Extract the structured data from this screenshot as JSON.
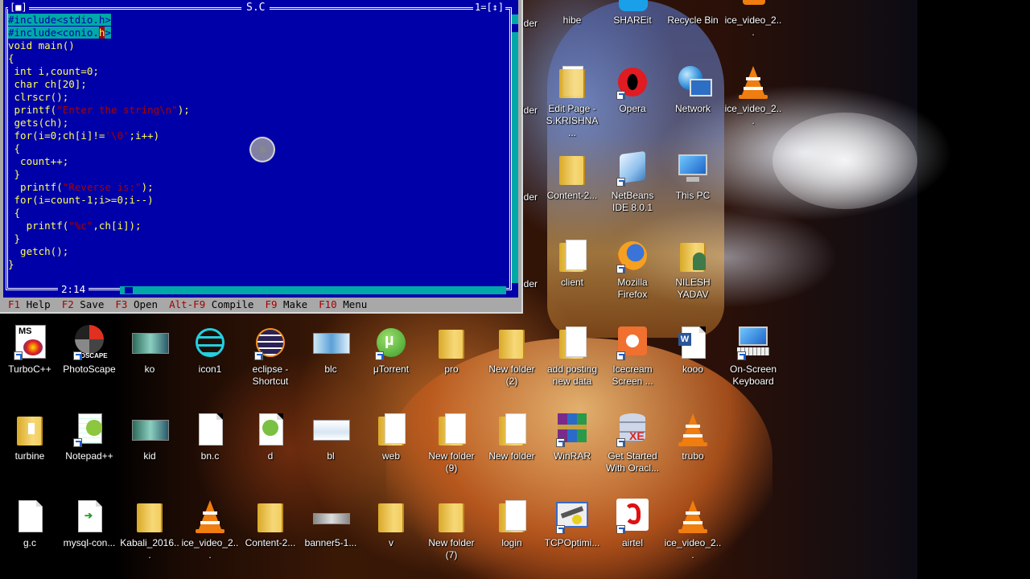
{
  "turbo_c": {
    "title": "S.C",
    "close_box": "[■]",
    "window_number": "1=[↕]",
    "cursor_position": "2:14",
    "code_lines": [
      "#include<stdio.h>",
      "#include<conio.h>",
      "void main()",
      "{",
      " int i,count=0;",
      " char ch[20];",
      " clrscr();",
      " printf(\"Enter the string\\n\");",
      " gets(ch);",
      " for(i=0;ch[i]!='\\0';i++)",
      " {",
      "  count++;",
      " }",
      "  printf(\"Reverse is:\");",
      " for(i=count-1;i>=0;i--)",
      " {",
      "   printf(\"%c\",ch[i]);",
      " }",
      "  getch();",
      "}"
    ],
    "menu": [
      {
        "key": "F1",
        "label": "Help"
      },
      {
        "key": "F2",
        "label": "Save"
      },
      {
        "key": "F3",
        "label": "Open"
      },
      {
        "key": "Alt-F9",
        "label": "Compile"
      },
      {
        "key": "F9",
        "label": "Make"
      },
      {
        "key": "F10",
        "label": "Menu"
      }
    ]
  },
  "desktop": {
    "top_partial_icons": {
      "hibe": "hibe",
      "shareit": "SHAREit",
      "recycle_bin": "Recycle Bin",
      "ice_video_top": "ice_video_2..."
    },
    "icons": {
      "edit_page": "Edit Page - S.KRISHNA ...",
      "opera": "Opera",
      "network": "Network",
      "ice_video_r1": "ice_video_2...",
      "content_2_top": "Content-2...",
      "netbeans": "NetBeans IDE 8.0.1",
      "this_pc": "This PC",
      "client": "client",
      "firefox": "Mozilla Firefox",
      "nilesh": "NILESH YADAV",
      "turboc": "TurboC++",
      "photoscape": "PhotoScape",
      "ko": "ko",
      "icon1": "icon1",
      "eclipse": "eclipse - Shortcut",
      "blc": "blc",
      "utorrent": "μTorrent",
      "pro": "pro",
      "new_folder_2": "New folder (2)",
      "add_posting": "add posting new data",
      "icecream": "Icecream Screen ...",
      "kooo": "kooo",
      "onscreen_keyboard": "On-Screen Keyboard",
      "turbine": "turbine",
      "notepadpp": "Notepad++",
      "kid": "kid",
      "bn_c": "bn.c",
      "d": "d",
      "bl": "bl",
      "web": "web",
      "new_folder_9": "New folder (9)",
      "new_folder": "New folder",
      "winrar": "WinRAR",
      "get_started_oracle": "Get Started With Oracl...",
      "trubo": "trubo",
      "g_c": "g.c",
      "mysql_con": "mysql-con...",
      "kabali": "Kabali_2016...",
      "ice_video_r6": "ice_video_2...",
      "content_2_bottom": "Content-2...",
      "banner5": "banner5-1...",
      "v": "v",
      "new_folder_7": "New folder (7)",
      "login": "login",
      "tcpoptimizer": "TCPOptimi...",
      "airtel": "airtel",
      "ice_video_r6b": "ice_video_2..."
    },
    "partial_labels": [
      "lder",
      "lder",
      "lder",
      "lder"
    ]
  }
}
